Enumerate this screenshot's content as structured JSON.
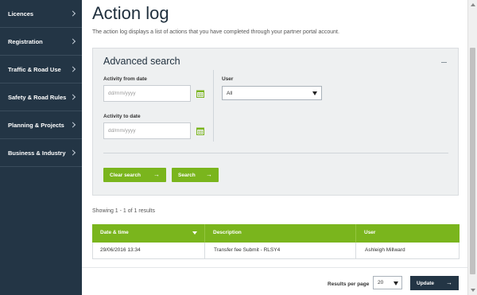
{
  "sidebar": {
    "items": [
      {
        "label": "Licences"
      },
      {
        "label": "Registration"
      },
      {
        "label": "Traffic & Road Use"
      },
      {
        "label": "Safety & Road Rules"
      },
      {
        "label": "Planning & Projects"
      },
      {
        "label": "Business & Industry"
      }
    ]
  },
  "page": {
    "title": "Action log",
    "description": "The action log displays a list of actions that you have completed through your partner portal account."
  },
  "search": {
    "title": "Advanced search",
    "from_label": "Activity from date",
    "from_placeholder": "dd/mm/yyyy",
    "to_label": "Activity to date",
    "to_placeholder": "dd/mm/yyyy",
    "user_label": "User",
    "user_value": "All",
    "clear_label": "Clear search",
    "search_label": "Search"
  },
  "results": {
    "summary": "Showing 1 - 1 of 1 results"
  },
  "table": {
    "headers": [
      "Date & time",
      "Description",
      "User"
    ],
    "rows": [
      [
        "29/06/2016 13:34",
        "Transfer fee Submit - RLSY4",
        "Ashleigh Millward"
      ]
    ]
  },
  "pagination": {
    "per_page_label": "Results per page",
    "per_page_value": "20",
    "update_label": "Update"
  },
  "colors": {
    "accent": "#7ab51d",
    "sidebar": "#233545"
  }
}
